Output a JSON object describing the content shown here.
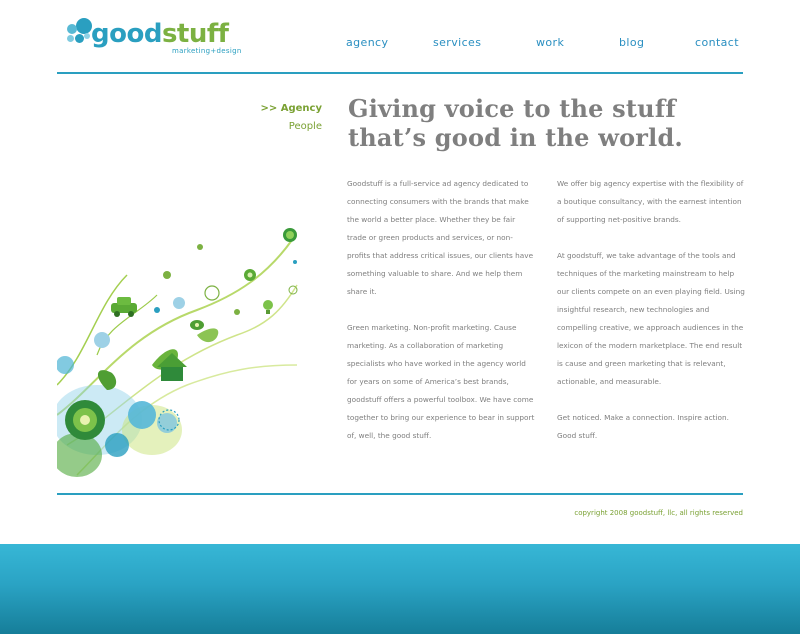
{
  "brand": {
    "name_part1": "good",
    "name_part2": "stuff",
    "tagline": "marketing+design"
  },
  "nav": [
    {
      "label": "agency"
    },
    {
      "label": "services"
    },
    {
      "label": "work"
    },
    {
      "label": "blog"
    },
    {
      "label": "contact"
    }
  ],
  "submenu": {
    "active": ">> Agency",
    "people": "People"
  },
  "headline": {
    "line1": "Giving voice to the stuff",
    "line2": "that’s good in the world."
  },
  "column1": [
    "Goodstuff is a full-service ad agency dedicated to connecting consumers with the brands that make the world a better place. Whether they be fair trade or green products and services, or non-profits that address critical issues, our clients have something valuable to share. And we help them share it.",
    "Green marketing. Non-profit marketing. Cause marketing. As a collaboration of marketing specialists who have worked in the agency world for years on some of America’s best brands, goodstuff offers a powerful toolbox. We have come together to bring our experience to bear in support of, well, the good stuff."
  ],
  "column2": [
    "We offer big agency expertise with the flexibility of a boutique consultancy, with the earnest intention of supporting net-positive brands.",
    "At goodstuff, we take advantage of the tools and techniques of the marketing mainstream to help our clients compete on an even playing field. Using insightful research, new technologies and compelling creative, we approach audiences in the lexicon of the modern marketplace. The end result is cause and green marketing that is relevant, actionable, and measurable.",
    "Get noticed. Make a connection. Inspire action. Good stuff."
  ],
  "footer": {
    "copyright": "copyright 2008 goodstuff, llc, all rights reserved"
  },
  "colors": {
    "brand_blue": "#2a9fc0",
    "brand_green": "#7cb142",
    "text_gray": "#7e7e7e",
    "band_teal": "#2aa3c4"
  },
  "icons": [
    "logo-dots-icon",
    "floral-illustration"
  ]
}
